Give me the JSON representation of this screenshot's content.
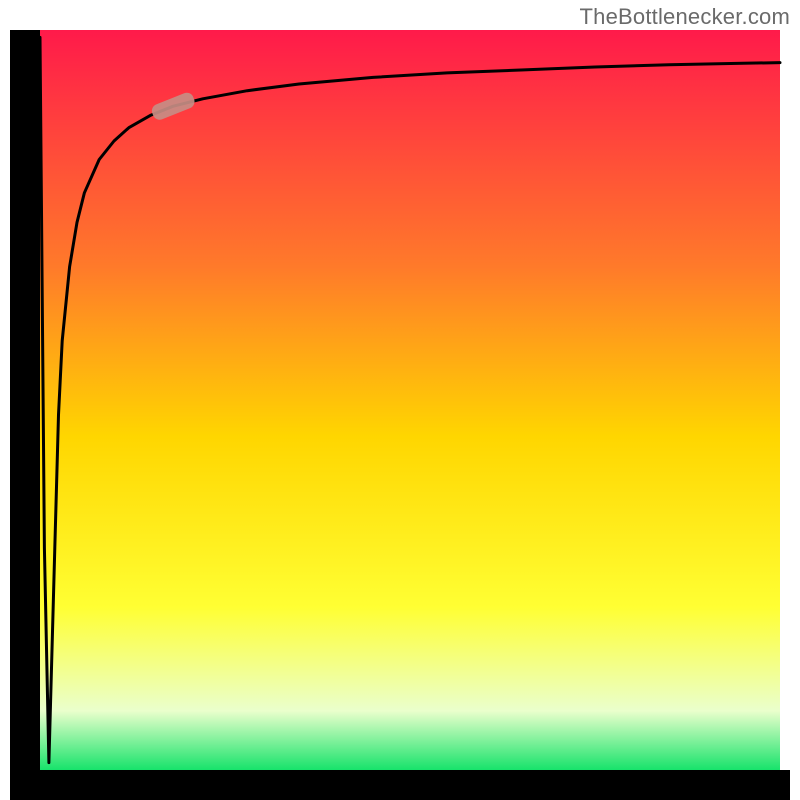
{
  "watermark": "TheBottlenecker.com",
  "colors": {
    "frame": "#000000",
    "curve": "#000000",
    "marker": "#c78d84",
    "grad_top": "#ff1a4a",
    "grad_mid1": "#ff7a2a",
    "grad_mid2": "#ffd600",
    "grad_mid3": "#ffff33",
    "grad_low": "#eaffcc",
    "grad_bottom": "#17e36b"
  },
  "chart_data": {
    "type": "line",
    "title": "",
    "xlabel": "",
    "ylabel": "",
    "xlim": [
      0,
      100
    ],
    "ylim": [
      0,
      100
    ],
    "legend": false,
    "grid": false,
    "x": [
      0,
      0.6,
      1.2,
      2,
      2.5,
      3,
      4,
      5,
      6,
      8,
      10,
      12,
      15,
      18,
      22,
      28,
      35,
      45,
      55,
      65,
      75,
      85,
      95,
      100
    ],
    "values": [
      99,
      30,
      1,
      30,
      48,
      58,
      68,
      74,
      78,
      82.5,
      85,
      86.8,
      88.5,
      89.7,
      90.7,
      91.8,
      92.7,
      93.6,
      94.2,
      94.6,
      95.0,
      95.3,
      95.5,
      95.6
    ],
    "marker": {
      "x": 18,
      "y": 89.7
    },
    "annotations": []
  }
}
